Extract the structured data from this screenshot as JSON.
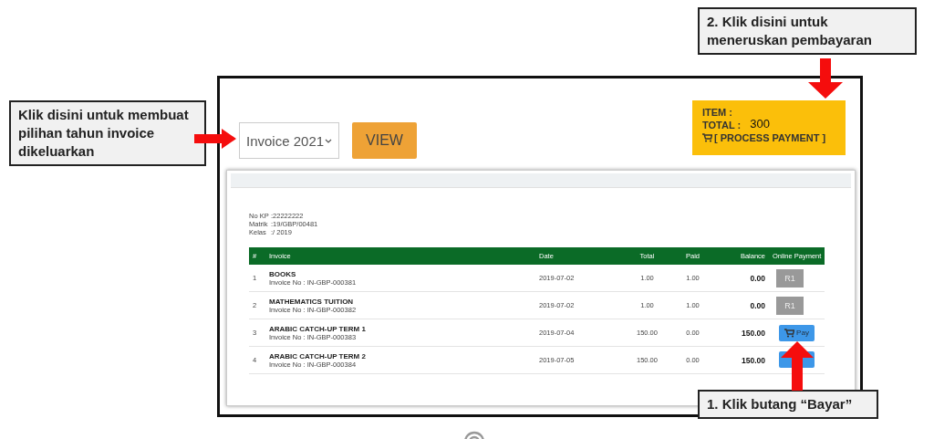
{
  "annotations": [
    {
      "text": "Klik disini untuk membuat pilihan tahun invoice dikeluarkan"
    },
    {
      "text": "2. Klik disini untuk meneruskan pembayaran"
    },
    {
      "text": "1. Klik butang “Bayar”"
    }
  ],
  "invoice_select": {
    "value": "Invoice 2021"
  },
  "view_button": "VIEW",
  "cart_summary": {
    "item_label": "ITEM :",
    "total_label": "TOTAL :",
    "total_value": "300",
    "action": "[ PROCESS PAYMENT ]"
  },
  "student": [
    {
      "label": "No KP",
      "value": ":22222222"
    },
    {
      "label": "Matrik",
      "value": ":19/GBP/00481"
    },
    {
      "label": "Kelas",
      "value": ":/ 2019"
    }
  ],
  "table": {
    "columns": [
      "#",
      "Invoice",
      "Date",
      "Total",
      "Paid",
      "Balance",
      "Online Payment"
    ],
    "rows": [
      {
        "no": "1",
        "title": "BOOKS",
        "invoice_no": "Invoice No : IN-GBP-000381",
        "date": "2019-07-02",
        "total": "1.00",
        "paid": "1.00",
        "balance": "0.00",
        "payment": {
          "kind": "receipt",
          "label": "R1"
        }
      },
      {
        "no": "2",
        "title": "MATHEMATICS TUITION",
        "invoice_no": "Invoice No : IN-GBP-000382",
        "date": "2019-07-02",
        "total": "1.00",
        "paid": "1.00",
        "balance": "0.00",
        "payment": {
          "kind": "receipt",
          "label": "R1"
        }
      },
      {
        "no": "3",
        "title": "ARABIC CATCH-UP TERM 1",
        "invoice_no": "Invoice No : IN-GBP-000383",
        "date": "2019-07-04",
        "total": "150.00",
        "paid": "0.00",
        "balance": "150.00",
        "payment": {
          "kind": "pay",
          "label": "Pay"
        }
      },
      {
        "no": "4",
        "title": "ARABIC CATCH-UP TERM 2",
        "invoice_no": "Invoice No : IN-GBP-000384",
        "date": "2019-07-05",
        "total": "150.00",
        "paid": "0.00",
        "balance": "150.00",
        "payment": {
          "kind": "pay"
        }
      }
    ]
  }
}
